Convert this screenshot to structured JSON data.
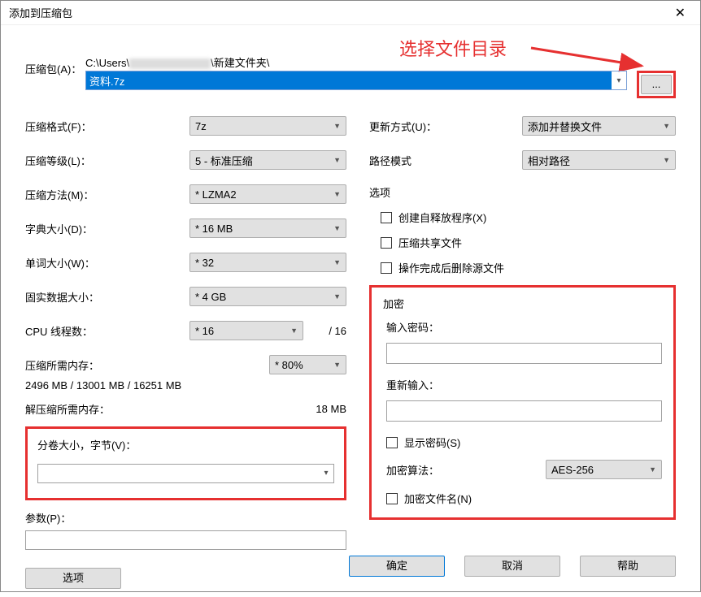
{
  "window_title": "添加到压缩包",
  "annotation": "选择文件目录",
  "archive": {
    "label": "压缩包(A)：",
    "path_prefix": "C:\\Users\\",
    "path_suffix": "\\新建文件夹\\",
    "value": "资料.7z",
    "browse": "..."
  },
  "left": {
    "format_label": "压缩格式(F)：",
    "format_value": "7z",
    "level_label": "压缩等级(L)：",
    "level_value": "5 - 标准压缩",
    "method_label": "压缩方法(M)：",
    "method_value": "* LZMA2",
    "dict_label": "字典大小(D)：",
    "dict_value": "* 16 MB",
    "word_label": "单词大小(W)：",
    "word_value": "* 32",
    "solid_label": "固实数据大小：",
    "solid_value": "* 4 GB",
    "threads_label": "CPU 线程数：",
    "threads_value": "* 16",
    "threads_max": "/ 16",
    "mem_compress_label": "压缩所需内存：",
    "mem_compress_combo": "* 80%",
    "mem_compress_value": "2496 MB / 13001 MB / 16251 MB",
    "mem_decompress_label": "解压缩所需内存：",
    "mem_decompress_value": "18 MB",
    "volume_label": "分卷大小，字节(V)：",
    "param_label": "参数(P)：",
    "options_btn": "选项"
  },
  "right": {
    "update_label": "更新方式(U)：",
    "update_value": "添加并替换文件",
    "pathmode_label": "路径模式",
    "pathmode_value": "相对路径",
    "options_group": "选项",
    "sfx_label": "创建自释放程序(X)",
    "shared_label": "压缩共享文件",
    "delete_label": "操作完成后删除源文件",
    "encryption": {
      "group": "加密",
      "enter_label": "输入密码：",
      "reenter_label": "重新输入：",
      "show_label": "显示密码(S)",
      "method_label": "加密算法：",
      "method_value": "AES-256",
      "names_label": "加密文件名(N)"
    }
  },
  "buttons": {
    "ok": "确定",
    "cancel": "取消",
    "help": "帮助"
  }
}
